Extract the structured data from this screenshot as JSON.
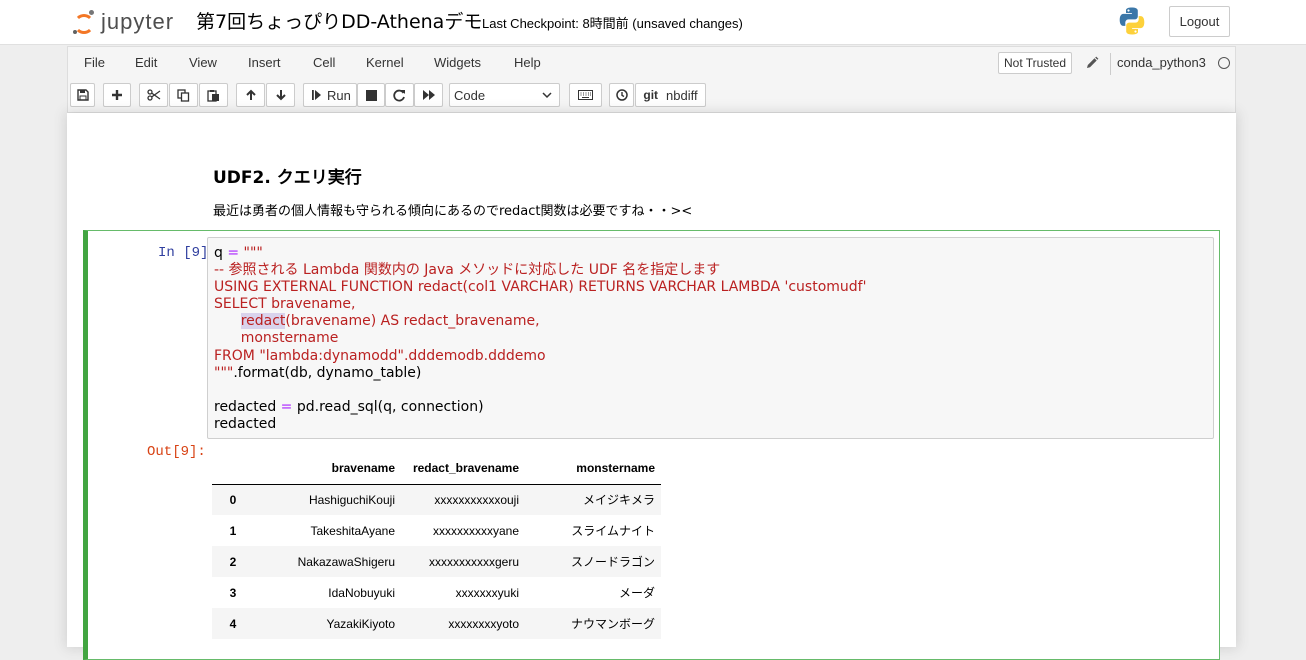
{
  "header": {
    "logo_text": "jupyter",
    "notebook_name": "第7回ちょっぴりDD-Athenaデモ",
    "checkpoint": "Last Checkpoint: 8時間前   (unsaved changes)",
    "logout_label": "Logout"
  },
  "menu": {
    "items": [
      "File",
      "Edit",
      "View",
      "Insert",
      "Cell",
      "Kernel",
      "Widgets",
      "Help"
    ],
    "trust_label": "Not Trusted",
    "kernel_name": "conda_python3"
  },
  "toolbar": {
    "run_label": "Run",
    "cell_type": "Code",
    "nbdiff_label": "nbdiff",
    "git_label": "git"
  },
  "markdown": {
    "heading": "UDF2. クエリ実行",
    "text": "最近は勇者の個人情報も守られる傾向にあるのでredact関数は必要ですね・・><"
  },
  "cell": {
    "in_prompt": "In [9]:",
    "out_prompt": "Out[9]:",
    "code": {
      "l1_var": "q ",
      "l1_op": "=",
      "l1_str": " \"\"\"",
      "l2": "-- 参照される Lambda 関数内の Java メソッドに対応した UDF 名を指定します",
      "l3": "USING EXTERNAL FUNCTION redact(col1 VARCHAR) RETURNS VARCHAR LAMBDA 'customudf'",
      "l4": "SELECT bravename,",
      "l5_indent": "      ",
      "l5_hl": "redact",
      "l5_rest": "(bravename) AS redact_bravename,",
      "l6": "      monstername",
      "l7": "FROM \"lambda:dynamodd\".dddemodb.dddemo",
      "l8_str": "\"\"\"",
      "l8_rest": ".format(db, dynamo_table)",
      "l10_var": "redacted ",
      "l10_op": "=",
      "l10_rest": " pd.read_sql(q, connection)",
      "l11": "redacted"
    }
  },
  "dataframe": {
    "columns": [
      "bravename",
      "redact_bravename",
      "monstername"
    ],
    "rows": [
      {
        "index": "0",
        "bravename": "HashiguchiKouji",
        "redact_bravename": "xxxxxxxxxxxouji",
        "monstername": "メイジキメラ"
      },
      {
        "index": "1",
        "bravename": "TakeshitaAyane",
        "redact_bravename": "xxxxxxxxxxyane",
        "monstername": "スライムナイト"
      },
      {
        "index": "2",
        "bravename": "NakazawaShigeru",
        "redact_bravename": "xxxxxxxxxxxgeru",
        "monstername": "スノードラゴン"
      },
      {
        "index": "3",
        "bravename": "IdaNobuyuki",
        "redact_bravename": "xxxxxxxyuki",
        "monstername": "メーダ"
      },
      {
        "index": "4",
        "bravename": "YazakiKiyoto",
        "redact_bravename": "xxxxxxxxyoto",
        "monstername": "ナウマンボーグ"
      }
    ]
  },
  "colors": {
    "accent_orange": "#f37726",
    "prompt_in": "#303f9f",
    "prompt_out": "#d84315",
    "string_red": "#ba2121",
    "operator_purple": "#aa22ff",
    "cell_selected_green": "#42a541"
  },
  "icons": [
    "jupyter-logo",
    "python-logo-icon",
    "pencil-icon",
    "kernel-idle-icon",
    "save-icon",
    "add-cell-icon",
    "cut-icon",
    "copy-icon",
    "paste-icon",
    "move-up-icon",
    "move-down-icon",
    "run-icon",
    "stop-icon",
    "restart-icon",
    "fast-forward-icon",
    "keyboard-icon",
    "history-icon"
  ]
}
